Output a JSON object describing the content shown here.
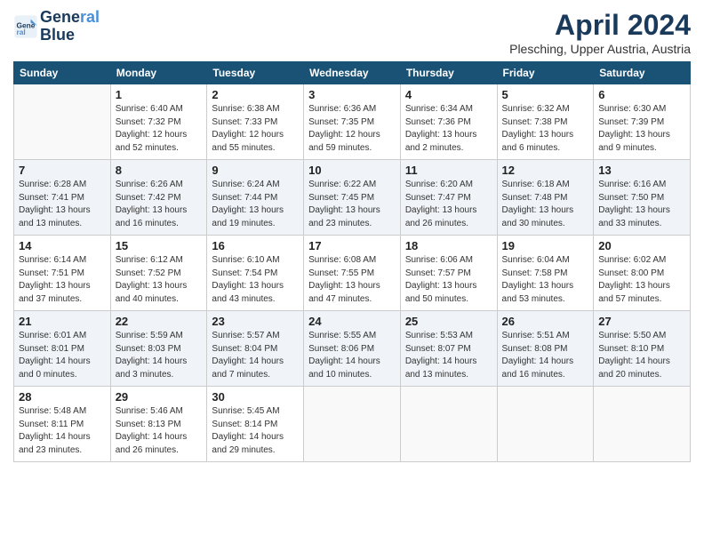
{
  "header": {
    "logo_line1": "General",
    "logo_line2": "Blue",
    "month_title": "April 2024",
    "location": "Plesching, Upper Austria, Austria"
  },
  "weekdays": [
    "Sunday",
    "Monday",
    "Tuesday",
    "Wednesday",
    "Thursday",
    "Friday",
    "Saturday"
  ],
  "weeks": [
    [
      {
        "day": "",
        "info": ""
      },
      {
        "day": "1",
        "info": "Sunrise: 6:40 AM\nSunset: 7:32 PM\nDaylight: 12 hours\nand 52 minutes."
      },
      {
        "day": "2",
        "info": "Sunrise: 6:38 AM\nSunset: 7:33 PM\nDaylight: 12 hours\nand 55 minutes."
      },
      {
        "day": "3",
        "info": "Sunrise: 6:36 AM\nSunset: 7:35 PM\nDaylight: 12 hours\nand 59 minutes."
      },
      {
        "day": "4",
        "info": "Sunrise: 6:34 AM\nSunset: 7:36 PM\nDaylight: 13 hours\nand 2 minutes."
      },
      {
        "day": "5",
        "info": "Sunrise: 6:32 AM\nSunset: 7:38 PM\nDaylight: 13 hours\nand 6 minutes."
      },
      {
        "day": "6",
        "info": "Sunrise: 6:30 AM\nSunset: 7:39 PM\nDaylight: 13 hours\nand 9 minutes."
      }
    ],
    [
      {
        "day": "7",
        "info": "Sunrise: 6:28 AM\nSunset: 7:41 PM\nDaylight: 13 hours\nand 13 minutes."
      },
      {
        "day": "8",
        "info": "Sunrise: 6:26 AM\nSunset: 7:42 PM\nDaylight: 13 hours\nand 16 minutes."
      },
      {
        "day": "9",
        "info": "Sunrise: 6:24 AM\nSunset: 7:44 PM\nDaylight: 13 hours\nand 19 minutes."
      },
      {
        "day": "10",
        "info": "Sunrise: 6:22 AM\nSunset: 7:45 PM\nDaylight: 13 hours\nand 23 minutes."
      },
      {
        "day": "11",
        "info": "Sunrise: 6:20 AM\nSunset: 7:47 PM\nDaylight: 13 hours\nand 26 minutes."
      },
      {
        "day": "12",
        "info": "Sunrise: 6:18 AM\nSunset: 7:48 PM\nDaylight: 13 hours\nand 30 minutes."
      },
      {
        "day": "13",
        "info": "Sunrise: 6:16 AM\nSunset: 7:50 PM\nDaylight: 13 hours\nand 33 minutes."
      }
    ],
    [
      {
        "day": "14",
        "info": "Sunrise: 6:14 AM\nSunset: 7:51 PM\nDaylight: 13 hours\nand 37 minutes."
      },
      {
        "day": "15",
        "info": "Sunrise: 6:12 AM\nSunset: 7:52 PM\nDaylight: 13 hours\nand 40 minutes."
      },
      {
        "day": "16",
        "info": "Sunrise: 6:10 AM\nSunset: 7:54 PM\nDaylight: 13 hours\nand 43 minutes."
      },
      {
        "day": "17",
        "info": "Sunrise: 6:08 AM\nSunset: 7:55 PM\nDaylight: 13 hours\nand 47 minutes."
      },
      {
        "day": "18",
        "info": "Sunrise: 6:06 AM\nSunset: 7:57 PM\nDaylight: 13 hours\nand 50 minutes."
      },
      {
        "day": "19",
        "info": "Sunrise: 6:04 AM\nSunset: 7:58 PM\nDaylight: 13 hours\nand 53 minutes."
      },
      {
        "day": "20",
        "info": "Sunrise: 6:02 AM\nSunset: 8:00 PM\nDaylight: 13 hours\nand 57 minutes."
      }
    ],
    [
      {
        "day": "21",
        "info": "Sunrise: 6:01 AM\nSunset: 8:01 PM\nDaylight: 14 hours\nand 0 minutes."
      },
      {
        "day": "22",
        "info": "Sunrise: 5:59 AM\nSunset: 8:03 PM\nDaylight: 14 hours\nand 3 minutes."
      },
      {
        "day": "23",
        "info": "Sunrise: 5:57 AM\nSunset: 8:04 PM\nDaylight: 14 hours\nand 7 minutes."
      },
      {
        "day": "24",
        "info": "Sunrise: 5:55 AM\nSunset: 8:06 PM\nDaylight: 14 hours\nand 10 minutes."
      },
      {
        "day": "25",
        "info": "Sunrise: 5:53 AM\nSunset: 8:07 PM\nDaylight: 14 hours\nand 13 minutes."
      },
      {
        "day": "26",
        "info": "Sunrise: 5:51 AM\nSunset: 8:08 PM\nDaylight: 14 hours\nand 16 minutes."
      },
      {
        "day": "27",
        "info": "Sunrise: 5:50 AM\nSunset: 8:10 PM\nDaylight: 14 hours\nand 20 minutes."
      }
    ],
    [
      {
        "day": "28",
        "info": "Sunrise: 5:48 AM\nSunset: 8:11 PM\nDaylight: 14 hours\nand 23 minutes."
      },
      {
        "day": "29",
        "info": "Sunrise: 5:46 AM\nSunset: 8:13 PM\nDaylight: 14 hours\nand 26 minutes."
      },
      {
        "day": "30",
        "info": "Sunrise: 5:45 AM\nSunset: 8:14 PM\nDaylight: 14 hours\nand 29 minutes."
      },
      {
        "day": "",
        "info": ""
      },
      {
        "day": "",
        "info": ""
      },
      {
        "day": "",
        "info": ""
      },
      {
        "day": "",
        "info": ""
      }
    ]
  ]
}
